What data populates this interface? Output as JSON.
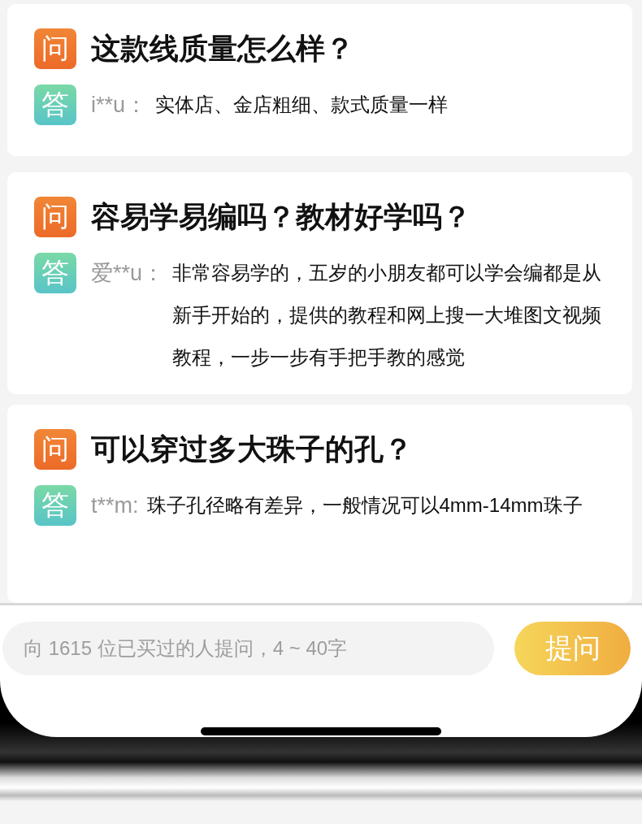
{
  "qa": [
    {
      "question_badge": "问",
      "question": "这款线质量怎么样？",
      "answer_badge": "答",
      "user": "i**u：",
      "answer": "实体店、金店粗细、款式质量一样"
    },
    {
      "question_badge": "问",
      "question": "容易学易编吗？教材好学吗？",
      "answer_badge": "答",
      "user": "爱**u：",
      "answer": "非常容易学的，五岁的小朋友都可以学会编都是从新手开始的，提供的教程和网上搜一大堆图文视频教程，一步一步有手把手教的感觉"
    },
    {
      "question_badge": "问",
      "question": "可以穿过多大珠子的孔？",
      "answer_badge": "答",
      "user": "t**m:",
      "answer": "珠子孔径略有差异，一般情况可以4mm-14mm珠子"
    }
  ],
  "ask_bar": {
    "placeholder": "向 1615 位已买过的人提问，4 ~ 40字",
    "button": "提问"
  }
}
